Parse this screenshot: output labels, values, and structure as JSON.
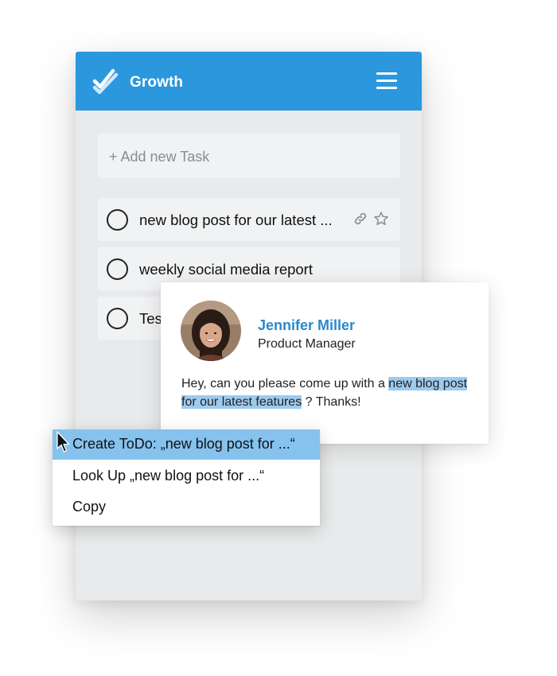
{
  "app": {
    "title": "Growth",
    "logo_icon": "double-check-icon",
    "menu_icon": "hamburger-icon",
    "header_color": "#2b97dd"
  },
  "add_task": {
    "placeholder": "+ Add new Task"
  },
  "tasks": [
    {
      "label": "new blog post for our latest ...",
      "done": false,
      "icons": [
        "link-icon",
        "star-icon"
      ]
    },
    {
      "label": "weekly social media report",
      "done": false
    },
    {
      "label": "Tes",
      "done": false
    }
  ],
  "message_card": {
    "sender_name": "Jennifer Miller",
    "sender_role": "Product Manager",
    "message_before": "Hey, can you please come up with a ",
    "message_highlight": "new blog post for our latest features",
    "message_after": " ? Thanks!",
    "highlight_color": "#9ccbf0",
    "name_color": "#2b88c9"
  },
  "context_menu": {
    "items": [
      {
        "label": "Create ToDo: „new blog post for ...“",
        "active": true
      },
      {
        "label": "Look Up „new blog post for ...“",
        "active": false
      },
      {
        "label": "Copy",
        "active": false
      }
    ],
    "active_color": "#86c2ee"
  },
  "cursor_icon": "arrow-cursor-icon"
}
